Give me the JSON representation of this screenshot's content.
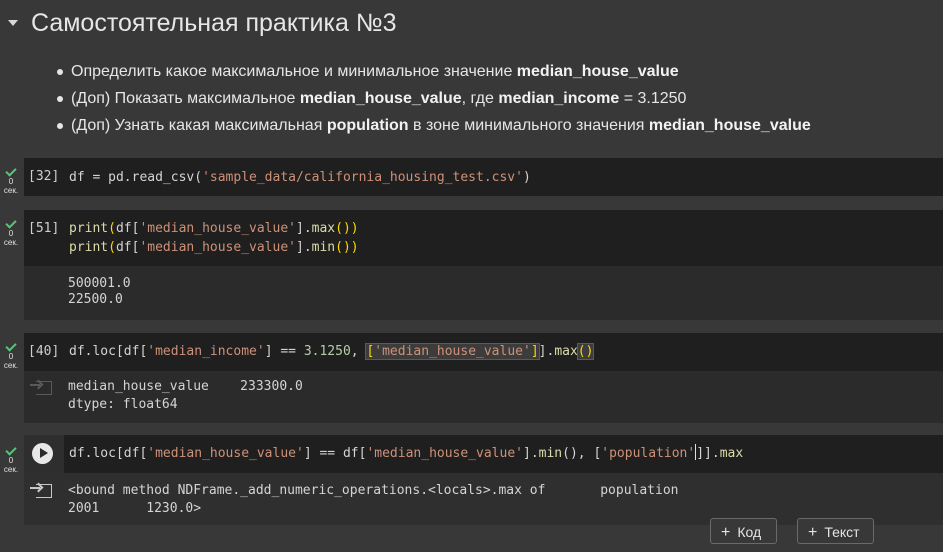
{
  "heading": {
    "title": "Самостоятельная практика №3"
  },
  "bullets": [
    {
      "parts": [
        "Определить какое максимальное и минимальное значение ",
        "median_house_value"
      ]
    },
    {
      "parts": [
        "(Доп) Показать максимальное ",
        "median_house_value",
        ", где ",
        "median_income",
        " = 3.1250"
      ]
    },
    {
      "parts": [
        "(Доп) Узнать какая максимальная ",
        "population",
        " в зоне минимального значения ",
        "median_house_value"
      ]
    }
  ],
  "status": {
    "time": "0",
    "unit": "сек."
  },
  "cells": [
    {
      "exec_count": "[32]",
      "code": [
        "df = pd.read_csv(",
        "'sample_data/california_housing_test.csv'",
        ")"
      ]
    },
    {
      "exec_count": "[51]",
      "code_line1": [
        "print",
        "(",
        "df[",
        "'median_house_value'",
        "].",
        "max",
        "()",
        ")"
      ],
      "code_line2": [
        "print",
        "(",
        "df[",
        "'median_house_value'",
        "].",
        "min",
        "()",
        ")"
      ],
      "output": [
        "500001.0",
        "22500.0"
      ]
    },
    {
      "exec_count": "[40]",
      "code": [
        "df.loc[df[",
        "'median_income'",
        "] == ",
        "3.1250",
        ", ",
        "[",
        "'median_house_value'",
        "]",
        "].",
        "max",
        "()"
      ],
      "output": [
        "median_house_value    233300.0",
        "dtype: float64"
      ]
    },
    {
      "code": [
        "df.loc[df[",
        "'median_house_value'",
        "] == df[",
        "'median_house_value'",
        "].",
        "min",
        "(), [",
        "'population'",
        "]].",
        "max"
      ],
      "output": [
        "<bound method NDFrame._add_numeric_operations.<locals>.max of       population",
        "2001      1230.0>"
      ]
    }
  ],
  "toolbar": {
    "add_code": "Код",
    "add_text": "Текст",
    "plus": "+"
  },
  "colors": {
    "background": "#383838",
    "code_bg": "#1f1f1f",
    "output_bg": "#2b2b2b",
    "string": "#ce9178",
    "success": "#5ac37a"
  }
}
